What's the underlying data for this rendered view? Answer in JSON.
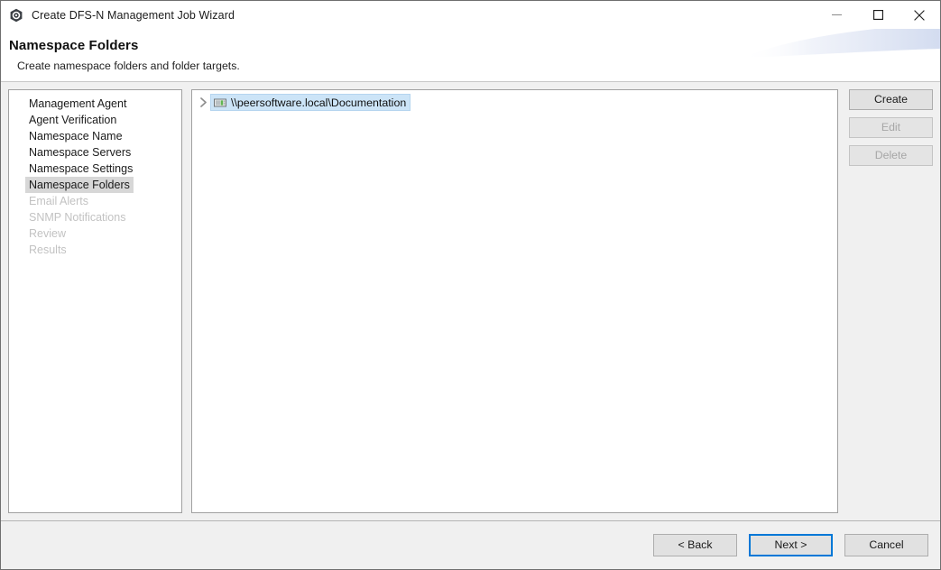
{
  "window": {
    "title": "Create DFS-N Management Job Wizard",
    "icon": "app-hexagon-icon",
    "controls": {
      "minimize": "minimize-icon",
      "maximize": "maximize-icon",
      "close": "close-icon"
    }
  },
  "header": {
    "title": "Namespace Folders",
    "subtitle": "Create namespace folders and folder targets.",
    "accent_color": "#dfe5f3"
  },
  "sidebar": {
    "items": [
      {
        "label": "Management Agent",
        "state": "completed"
      },
      {
        "label": "Agent Verification",
        "state": "completed"
      },
      {
        "label": "Namespace Name",
        "state": "completed"
      },
      {
        "label": "Namespace Servers",
        "state": "completed"
      },
      {
        "label": "Namespace Settings",
        "state": "completed"
      },
      {
        "label": "Namespace Folders",
        "state": "selected"
      },
      {
        "label": "Email Alerts",
        "state": "disabled"
      },
      {
        "label": "SNMP Notifications",
        "state": "disabled"
      },
      {
        "label": "Review",
        "state": "disabled"
      },
      {
        "label": "Results",
        "state": "disabled"
      }
    ],
    "selected_bg": "#d7d7d7",
    "disabled_color": "#c2c2c2"
  },
  "main": {
    "tree": {
      "nodes": [
        {
          "label": "\\\\peersoftware.local\\Documentation",
          "icon": "namespace-server-icon",
          "expander": "chevron-right-icon",
          "expanded": false,
          "selected": true
        }
      ],
      "selection_color": "#cce4f7"
    }
  },
  "actions": {
    "create_label": "Create",
    "edit_label": "Edit",
    "delete_label": "Delete",
    "create_enabled": true,
    "edit_enabled": false,
    "delete_enabled": false
  },
  "footer": {
    "back_label": "< Back",
    "next_label": "Next >",
    "cancel_label": "Cancel",
    "default_button": "Next >",
    "focus_color": "#0078d7"
  }
}
